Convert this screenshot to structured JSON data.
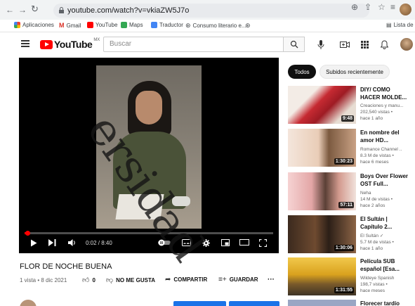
{
  "browser": {
    "url": "youtube.com/watch?v=vkiaZW5J7o",
    "bookmarks": [
      "Aplicaciones",
      "Gmail",
      "YouTube",
      "Maps",
      "Traductor",
      "Consumo literario e...",
      "Lista de le"
    ],
    "icons": [
      "back-icon",
      "forward-icon",
      "reload-icon",
      "lock-icon",
      "share-icon",
      "star-icon",
      "extension-icon"
    ]
  },
  "header": {
    "logo_text": "YouTube",
    "country": "MX",
    "search_placeholder": "Buscar"
  },
  "player": {
    "current_time": "0:02",
    "duration": "8:40",
    "progress_fraction": 0.004
  },
  "video": {
    "title": "FLOR DE NOCHE BUENA",
    "meta": "1 vista • 8 dic 2021",
    "likes": "0",
    "dislike_label": "NO ME GUSTA",
    "share_label": "COMPARTIR",
    "save_label": "GUARDAR",
    "more_label": "···"
  },
  "sidebar": {
    "chips": [
      "Todos",
      "Subidos recientemente"
    ],
    "recommendations": [
      {
        "title": "DIY/ COMO\nHACER MOLDE...",
        "meta": "Creaciones y manu...\n202,540 vistas •\nhace 1 año",
        "duration": "9:48",
        "thumb": "#c62a32"
      },
      {
        "title": "En nombre del\namor HD...",
        "meta": "Romance Channel ..\n8.3 M de vistas •\nhace 6 meses",
        "duration": "1:30:23",
        "thumb": "#d8b89a"
      },
      {
        "title": "Boys Over Flower\nOST Full...",
        "meta": "Neha\n14 M de vistas •\nhace 2 años",
        "duration": "57:11",
        "thumb": "#e3a6a6"
      },
      {
        "title": "El Sultán |\nCapítulo 2...",
        "meta": "El Sultán ✓\n5.7 M de vistas •\nhace 1 año",
        "duration": "1:30:06",
        "thumb": "#6e4a30"
      },
      {
        "title": "Película SUB\nespañol [Esa...",
        "meta": "Wildeye Spanish\n198,7 vistas •\nhace meses",
        "duration": "1:31:55",
        "thumb": "#d9a21e"
      },
      {
        "title": "Florecer tardío",
        "meta": "",
        "duration": "",
        "thumb": "#9aa6c4"
      }
    ]
  },
  "watermark": "ersidad",
  "colors": {
    "accent": "#ff0000",
    "chip_active": "#0f0f0f",
    "button_blue": "#1a73e8"
  }
}
